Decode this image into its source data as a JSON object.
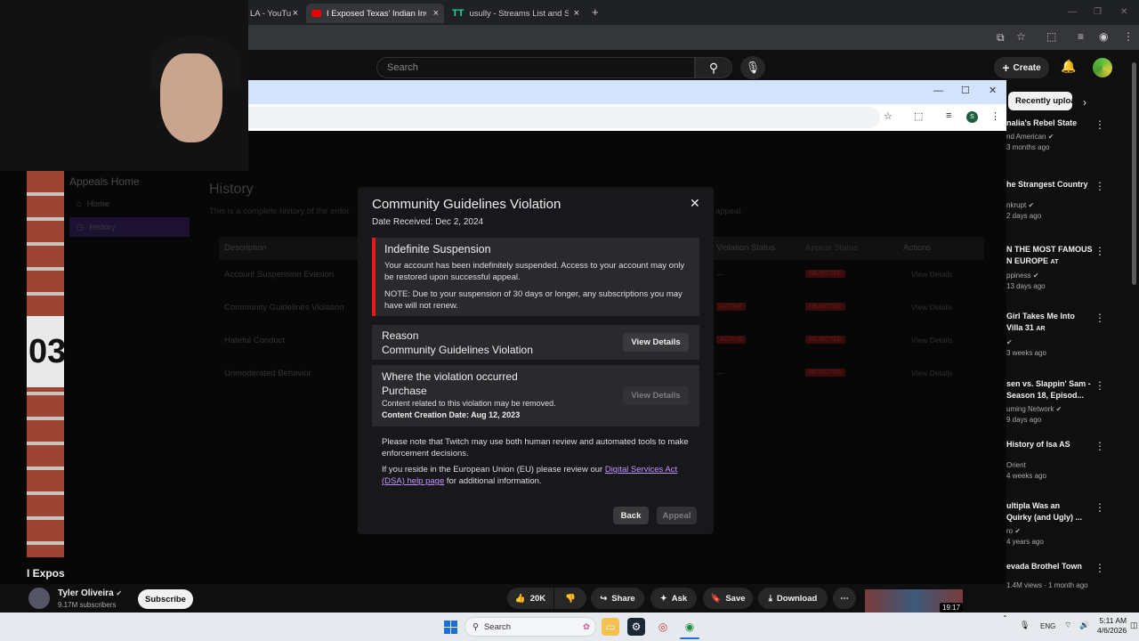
{
  "browser": {
    "tabs": [
      {
        "label": "LA - YouTu",
        "close": "×"
      },
      {
        "label": "I Exposed Texas' Indian Invasion",
        "close": "×"
      },
      {
        "label": "usully - Streams List and Statistics",
        "close": "×"
      }
    ],
    "new_tab": "+"
  },
  "youtube": {
    "search_placeholder": "Search",
    "create_label": "Create",
    "recent_chip": "Recently uploaded",
    "video_title": "I Expos",
    "channel_name": "Tyler Oliveira",
    "channel_subs": "9.17M subscribers",
    "subscribe_label": "Subscribe",
    "like_count": "20K",
    "share_label": "Share",
    "ask_label": "Ask",
    "save_label": "Save",
    "download_label": "Download",
    "thumb_duration": "19:17",
    "recommendations": [
      {
        "title": "nalia's Rebel State",
        "channel": "nd American",
        "meta": "3 months ago",
        "verified": true
      },
      {
        "title": "he Strangest Country",
        "channel": "nkrupt",
        "meta": "2 days ago",
        "verified": true
      },
      {
        "title": "N THE MOST FAMOUS",
        "title2": "N EUROPE",
        "tag": "AT",
        "channel": "ppiness",
        "meta": "13 days ago",
        "verified": true
      },
      {
        "title": "Girl Takes Me Into",
        "title2": "Villa 31",
        "tag": "AR",
        "channel": "",
        "meta": "3 weeks ago",
        "verified": true
      },
      {
        "title": "sen vs. Slappin' Sam -",
        "title2": "Season 18, Episod...",
        "channel": "uming Network",
        "meta": "9 days ago",
        "verified": true
      },
      {
        "title": "History of Isa AS",
        "channel": "Orient",
        "meta": "4 weeks ago",
        "verified": false
      },
      {
        "title": "ultipla Was an",
        "title2": "Quirky (and Ugly) ...",
        "channel": "ro",
        "meta": "4 years ago",
        "verified": true
      },
      {
        "title": "evada Brothel Town",
        "channel": "1.4M views",
        "meta": "1 month ago",
        "verified": false
      }
    ]
  },
  "background_page": {
    "sidebar_title": "Appeals Home",
    "nav": [
      {
        "label": "Home"
      },
      {
        "label": "History"
      }
    ],
    "heading": "History",
    "subtext": "This is a complete history of the enfor",
    "subtext_end": "submit an appeal.",
    "columns": [
      "Description",
      "Violation Status",
      "Appeal Status",
      "Actions"
    ],
    "rows": [
      {
        "desc": "Account Suspension Evasion",
        "vstatus": "—",
        "astatus": "REJECTED",
        "action": "View Details"
      },
      {
        "desc": "Community Guidelines Violation",
        "vstatus": "ACTIVE",
        "astatus": "REJECTED",
        "action": "View Details"
      },
      {
        "desc": "Hateful Conduct",
        "vstatus": "ACTIVE",
        "astatus": "REJECTED",
        "action": "View Details"
      },
      {
        "desc": "Unmoderated Behavior",
        "vstatus": "—",
        "astatus": "REJECTED",
        "action": "View Details"
      }
    ]
  },
  "modal": {
    "title": "Community Guidelines Violation",
    "date_received": "Date Received: Dec 2, 2024",
    "alert_title": "Indefinite Suspension",
    "alert_body": "Your account has been indefinitely suspended. Access to your account may only be restored upon successful appeal.",
    "alert_note": "NOTE: Due to your suspension of 30 days or longer, any subscriptions you may have will not renew.",
    "reason_label": "Reason",
    "reason_value": "Community Guidelines Violation",
    "view_details": "View Details",
    "where_label": "Where the violation occurred",
    "where_value": "Purchase",
    "where_note": "Content related to this violation may be removed.",
    "content_date": "Content Creation Date: Aug 12, 2023",
    "para1": "Please note that Twitch may use both human review and automated tools to make enforcement decisions.",
    "para2_pre": "If you reside in the European Union (EU) please review our ",
    "para2_link": "Digital Services Act (DSA) help page",
    "para2_post": " for additional information.",
    "back_label": "Back",
    "appeal_label": "Appeal"
  },
  "webcam_plate": "03",
  "taskbar": {
    "search_placeholder": "Search",
    "lang": "ENG",
    "time": "5:11 AM",
    "date": "4/6/2026"
  },
  "colors": {
    "twitch_purple_link": "#bf94ff",
    "alert_red": "#e91916",
    "modal_bg": "#18181b"
  }
}
